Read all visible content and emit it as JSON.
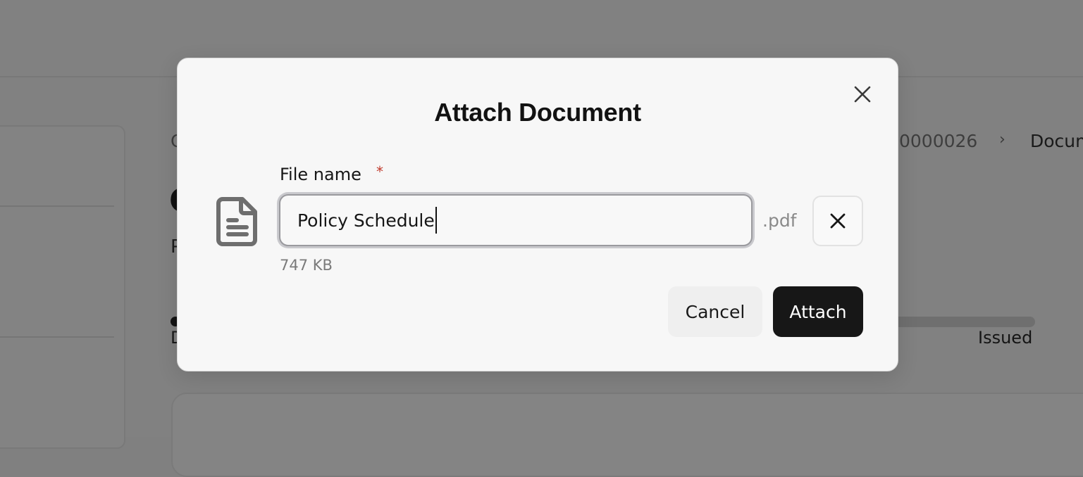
{
  "background": {
    "breadcrumb_partial_left": "C",
    "breadcrumb_id": "0000026",
    "breadcrumb_current": "Docum",
    "heading_partial": "C",
    "subtext_partial": "P",
    "progress_start_partial": "D",
    "progress_end_label": "Issued"
  },
  "dialog": {
    "title": "Attach Document",
    "close_icon": "close-icon",
    "file_icon": "document-icon",
    "file_name_label": "File name",
    "required_marker": "*",
    "file_name_value": "Policy Schedule",
    "extension": ".pdf",
    "remove_icon": "close-icon",
    "file_size": "747 KB",
    "cancel_label": "Cancel",
    "attach_label": "Attach"
  },
  "colors": {
    "overlay": "#818181",
    "modal_bg": "#f7f7f7",
    "primary_button": "#171717",
    "required": "#c0392b"
  }
}
